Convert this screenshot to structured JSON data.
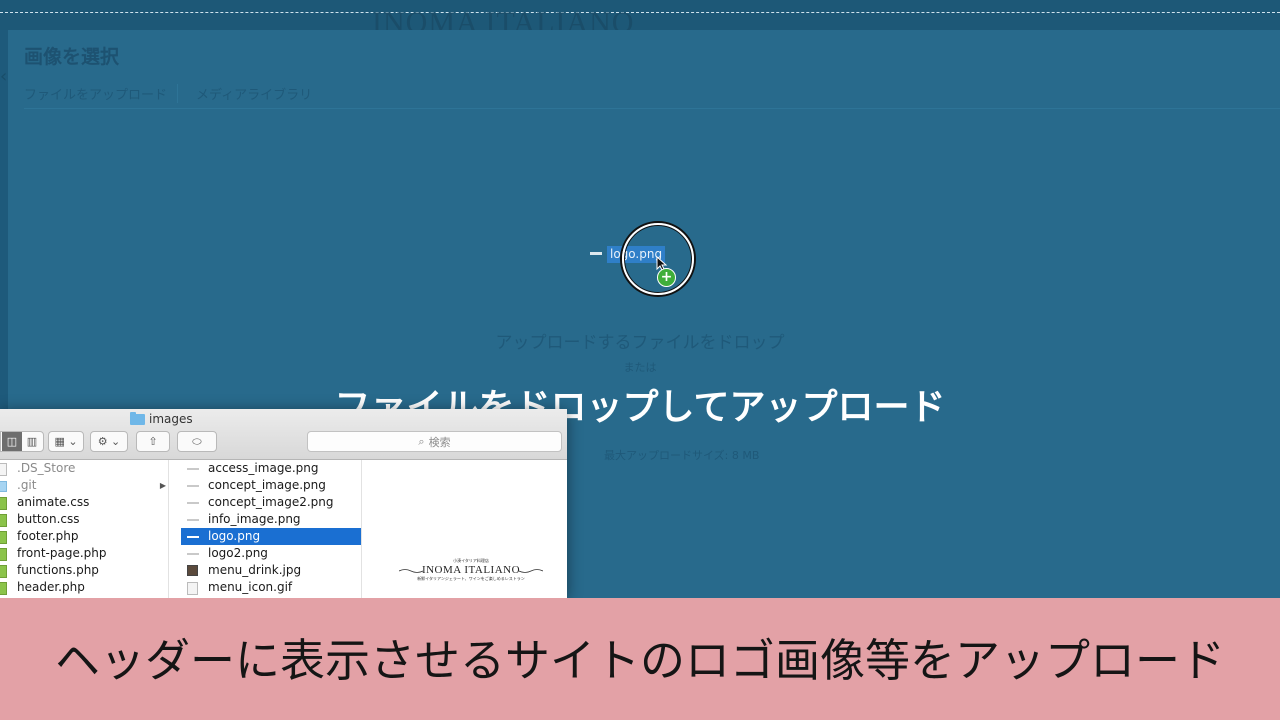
{
  "site": {
    "title": "INOMA ITALIANO"
  },
  "modal": {
    "title": "画像を選択",
    "tabs": [
      "ファイルをアップロード",
      "メディアライブラリ"
    ],
    "drop_main": "アップロードするファイルをドロップ",
    "drop_or": "または",
    "max_size": "最大アップロードサイズ: 8 MB",
    "drop_heading": "ファイルをドロップしてアップロード"
  },
  "drag": {
    "filename": "logo.png"
  },
  "finder": {
    "title": "images",
    "search_placeholder": "検索",
    "column1": [
      {
        "name": ".DS_Store",
        "kind": "file",
        "dim": true
      },
      {
        "name": ".git",
        "kind": "folder",
        "dim": true
      },
      {
        "name": "animate.css",
        "kind": "css"
      },
      {
        "name": "button.css",
        "kind": "css"
      },
      {
        "name": "footer.php",
        "kind": "php"
      },
      {
        "name": "front-page.php",
        "kind": "php"
      },
      {
        "name": "functions.php",
        "kind": "php"
      },
      {
        "name": "header.php",
        "kind": "php"
      }
    ],
    "column2": [
      {
        "name": "access_image.png",
        "kind": "img"
      },
      {
        "name": "concept_image.png",
        "kind": "img"
      },
      {
        "name": "concept_image2.png",
        "kind": "img"
      },
      {
        "name": "info_image.png",
        "kind": "img"
      },
      {
        "name": "logo.png",
        "kind": "img",
        "selected": true
      },
      {
        "name": "logo2.png",
        "kind": "img"
      },
      {
        "name": "menu_drink.jpg",
        "kind": "jpg"
      },
      {
        "name": "menu_icon.gif",
        "kind": "file"
      }
    ],
    "preview": {
      "small": "小湊イタリア料理店",
      "main": "INOMA ITALIANO",
      "tag": "新鮮イタリアンジェラート、ワインをご楽しめるレストラン"
    }
  },
  "caption": {
    "text": "ヘッダーに表示させるサイトのロゴ画像等をアップロード"
  }
}
